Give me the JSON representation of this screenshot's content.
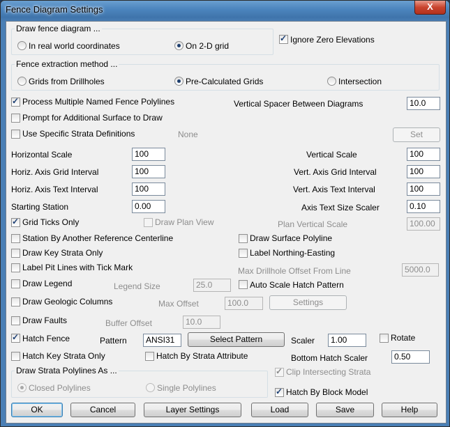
{
  "window": {
    "title": "Fence Diagram Settings",
    "close": "X"
  },
  "draw_fence": {
    "group_title": "Draw fence diagram ...",
    "real_world": "In real world coordinates",
    "grid_2d": "On 2-D grid",
    "selected": "On 2-D grid"
  },
  "ignore_zero": {
    "label": "Ignore Zero Elevations",
    "checked": true
  },
  "extraction": {
    "group_title": "Fence extraction method ...",
    "grids_from_drillholes": "Grids from Drillholes",
    "pre_calculated": "Pre-Calculated Grids",
    "intersection": "Intersection",
    "selected": "Pre-Calculated Grids"
  },
  "options": {
    "process_multiple": {
      "label": "Process Multiple Named Fence Polylines",
      "checked": true
    },
    "prompt_surface": {
      "label": "Prompt for Additional Surface to Draw",
      "checked": false
    },
    "specific_strata": {
      "label": "Use Specific Strata Definitions",
      "checked": false,
      "value": "None",
      "button": "Set"
    }
  },
  "vertical_spacer": {
    "label": "Vertical Spacer Between Diagrams",
    "value": "10.0"
  },
  "scales": {
    "horizontal_scale": {
      "label": "Horizontal Scale",
      "value": "100"
    },
    "horiz_grid": {
      "label": "Horiz. Axis Grid Interval",
      "value": "100"
    },
    "horiz_text": {
      "label": "Horiz. Axis Text Interval",
      "value": "100"
    },
    "starting_station": {
      "label": "Starting Station",
      "value": "0.00"
    },
    "vertical_scale": {
      "label": "Vertical Scale",
      "value": "100"
    },
    "vert_grid": {
      "label": "Vert. Axis Grid Interval",
      "value": "100"
    },
    "vert_text": {
      "label": "Vert. Axis Text Interval",
      "value": "100"
    },
    "axis_text_size": {
      "label": "Axis Text Size Scaler",
      "value": "0.10"
    }
  },
  "grid_ticks": {
    "label": "Grid Ticks Only",
    "checked": true
  },
  "draw_plan_view": {
    "label": "Draw Plan View",
    "checked": false
  },
  "plan_vertical_scale": {
    "label": "Plan Vertical Scale",
    "value": "100.00"
  },
  "station_ref": {
    "label": "Station By Another Reference Centerline",
    "checked": false
  },
  "draw_surface_polyline": {
    "label": "Draw Surface Polyline",
    "checked": false
  },
  "draw_key_strata": {
    "label": "Draw Key Strata Only",
    "checked": false
  },
  "label_northing": {
    "label": "Label Northing-Easting",
    "checked": false
  },
  "label_pit_lines": {
    "label": "Label Pit Lines with Tick Mark",
    "checked": false
  },
  "max_drillhole_offset": {
    "label": "Max Drillhole Offset From Line",
    "value": "5000.0"
  },
  "draw_legend": {
    "label": "Draw Legend",
    "checked": false,
    "size_label": "Legend Size",
    "size_value": "25.0"
  },
  "auto_scale_hatch": {
    "label": "Auto Scale Hatch Pattern",
    "checked": false
  },
  "geologic_columns": {
    "label": "Draw Geologic Columns",
    "checked": false,
    "offset_label": "Max Offset",
    "offset_value": "100.0",
    "settings_button": "Settings"
  },
  "draw_faults": {
    "label": "Draw Faults",
    "checked": false,
    "buffer_label": "Buffer Offset",
    "buffer_value": "10.0"
  },
  "hatch_fence": {
    "label": "Hatch Fence",
    "checked": true,
    "pattern_label": "Pattern",
    "pattern_value": "ANSI31",
    "select_button": "Select Pattern",
    "scaler_label": "Scaler",
    "scaler_value": "1.00",
    "rotate_label": "Rotate",
    "rotate_checked": false
  },
  "hatch_key_strata": {
    "label": "Hatch Key Strata Only",
    "checked": false
  },
  "hatch_by_attribute": {
    "label": "Hatch By Strata Attribute",
    "checked": false
  },
  "bottom_hatch": {
    "label": "Bottom Hatch Scaler",
    "value": "0.50"
  },
  "strata_polylines": {
    "group_title": "Draw Strata Polylines As ...",
    "closed": "Closed Polylines",
    "single": "Single Polylines",
    "selected": "Closed Polylines"
  },
  "clip_intersecting": {
    "label": "Clip Intersecting Strata",
    "checked": true
  },
  "hatch_block_model": {
    "label": "Hatch By Block Model",
    "checked": true
  },
  "buttons": {
    "ok": "OK",
    "cancel": "Cancel",
    "layer_settings": "Layer Settings",
    "load": "Load",
    "save": "Save",
    "help": "Help"
  }
}
